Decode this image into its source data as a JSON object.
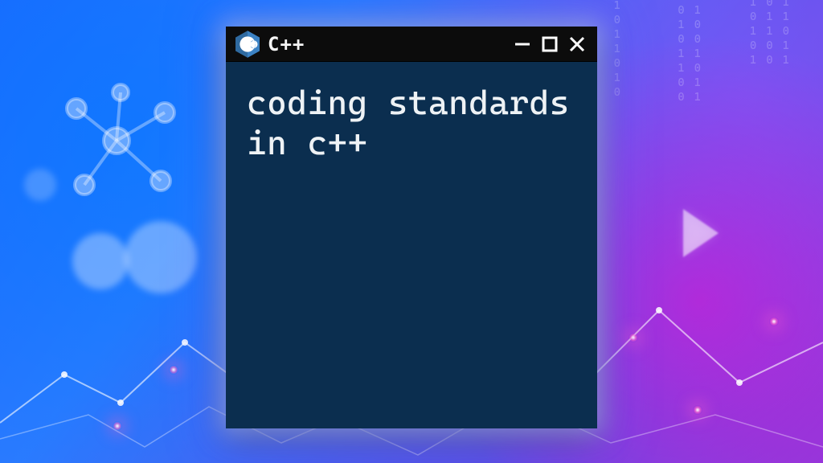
{
  "window": {
    "title": "C++",
    "logo_name": "cpp-hexagon-icon",
    "controls": {
      "minimize_name": "minimize-icon",
      "maximize_name": "maximize-icon",
      "close_name": "close-icon"
    }
  },
  "terminal": {
    "text": "coding standards in c++",
    "bg_color": "#0b2e4f",
    "fg_color": "#eef2f5"
  },
  "background": {
    "binary_columns": [
      "1 0 1\n0 1 1\n1 1 0\n0 0 1\n1 0 1",
      "0 1\n1 0\n0 0\n1 1\n1 0\n0 1\n0 1",
      "1\n0\n1\n1\n0\n1\n0"
    ],
    "gradient_colors": [
      "#1d6bff",
      "#5a52e8",
      "#8c3bdc"
    ],
    "flare_color": "#ff64c8"
  }
}
